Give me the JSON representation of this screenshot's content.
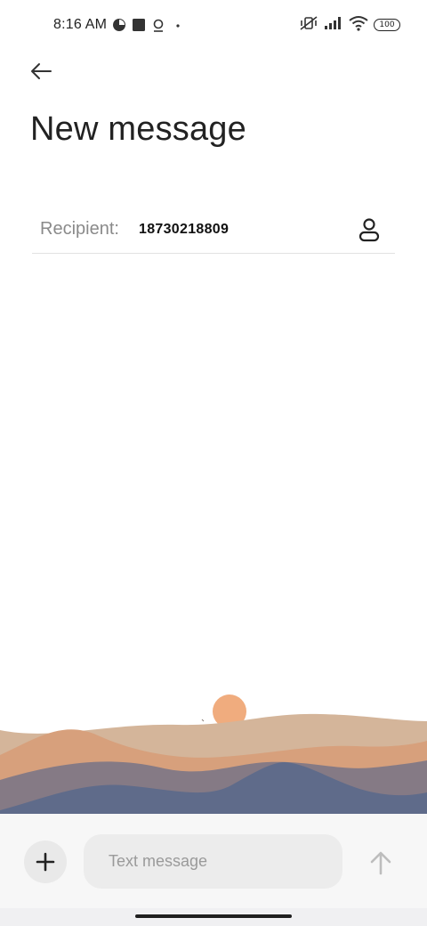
{
  "status_bar": {
    "time": "8:16 AM",
    "battery": "100",
    "left_icons": [
      "pie-status-icon",
      "square-status-icon",
      "location-pin-icon",
      "dot-icon"
    ],
    "right_icons": [
      "muted-vibrate-icon",
      "signal-icon",
      "wifi-icon",
      "battery-icon"
    ]
  },
  "header": {
    "back_icon": "back-arrow-icon",
    "title": "New message"
  },
  "recipient": {
    "label": "Recipient:",
    "value": "18730218809",
    "contact_icon": "person-icon"
  },
  "compose": {
    "add_icon": "plus-icon",
    "placeholder": "Text message",
    "value": "",
    "send_icon": "up-arrow-icon"
  },
  "colors": {
    "sun": "#F0AC7E",
    "dune_light": "#D4B59A",
    "dune_orange": "#D7A07C",
    "mountain_mid": "#857A85",
    "mountain_dark": "#5F6B8A",
    "send_disabled": "#BDBDBD"
  }
}
